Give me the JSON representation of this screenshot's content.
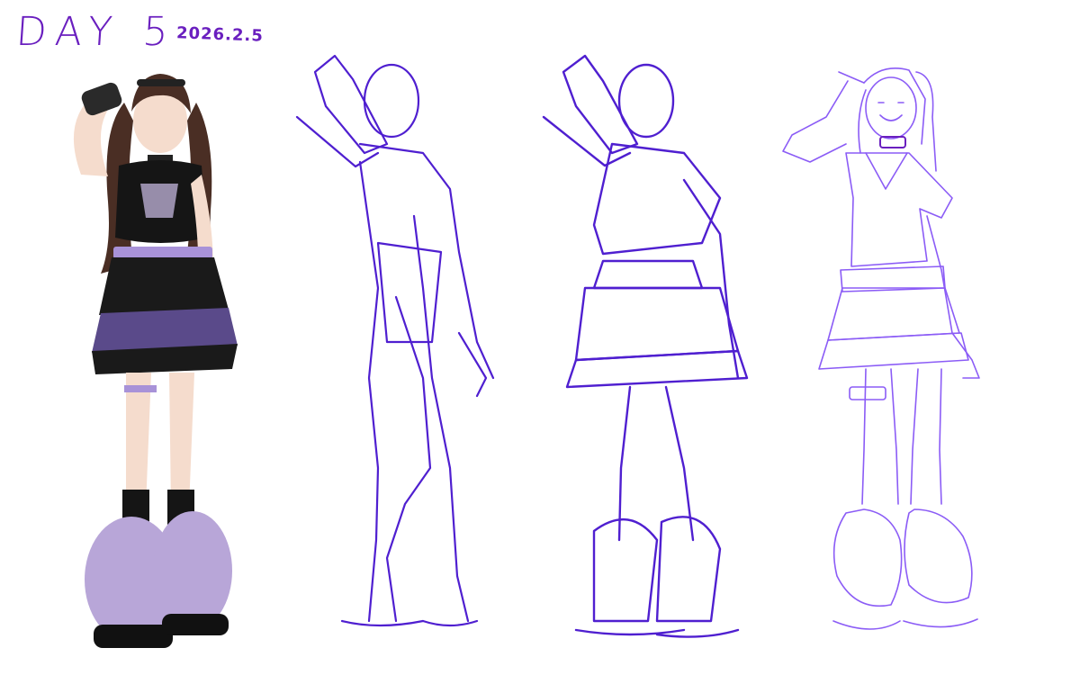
{
  "header": {
    "title": "DAY 5",
    "date": "2026.2.5"
  },
  "palette": {
    "ink_dark": "#4f1fd0",
    "ink_light": "#8b5cf6",
    "lavender": "#a892d8",
    "skirt_black": "#1a1a1a",
    "skin": "#f5dccd"
  },
  "panels": [
    {
      "id": "reference-photo",
      "kind": "photo"
    },
    {
      "id": "gesture-sketch",
      "kind": "sketch"
    },
    {
      "id": "outfit-sketch",
      "kind": "sketch"
    },
    {
      "id": "clean-lineart",
      "kind": "lineart"
    }
  ]
}
